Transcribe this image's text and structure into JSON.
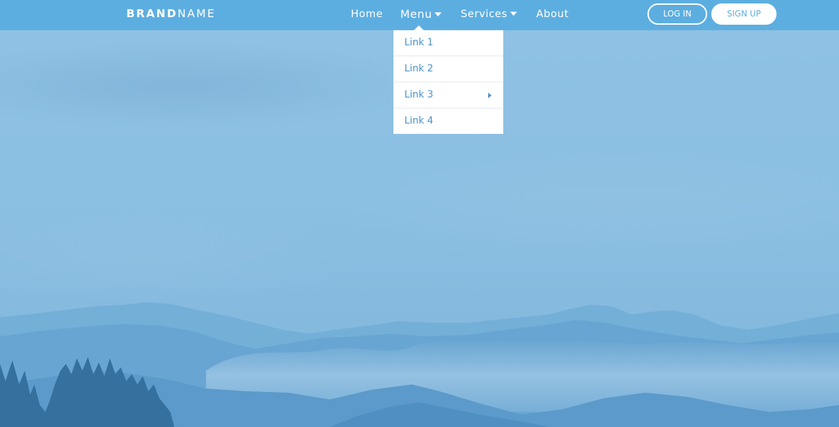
{
  "navbar": {
    "brand_bold": "BRAND",
    "brand_light": "NAME",
    "items": [
      {
        "label": "Home"
      },
      {
        "label": "Menu"
      },
      {
        "label": "Services"
      },
      {
        "label": "About"
      }
    ],
    "login_label": "LOG IN",
    "signup_label": "SIGN UP"
  },
  "dropdown": {
    "items": [
      {
        "label": "Link 1"
      },
      {
        "label": "Link 2"
      },
      {
        "label": "Link 3"
      },
      {
        "label": "Link 4"
      }
    ]
  },
  "colors": {
    "navbar": "#5daee0",
    "accent_text": "#4b93c8",
    "sky": "#8cc0e2",
    "mountain_far": "#6aa8d4",
    "mountain_near": "#4f8fc2",
    "trees": "#35709f"
  },
  "icons": {
    "menu_caret": "caret-down-icon",
    "services_caret": "caret-down-icon",
    "submenu_caret": "caret-right-icon"
  }
}
